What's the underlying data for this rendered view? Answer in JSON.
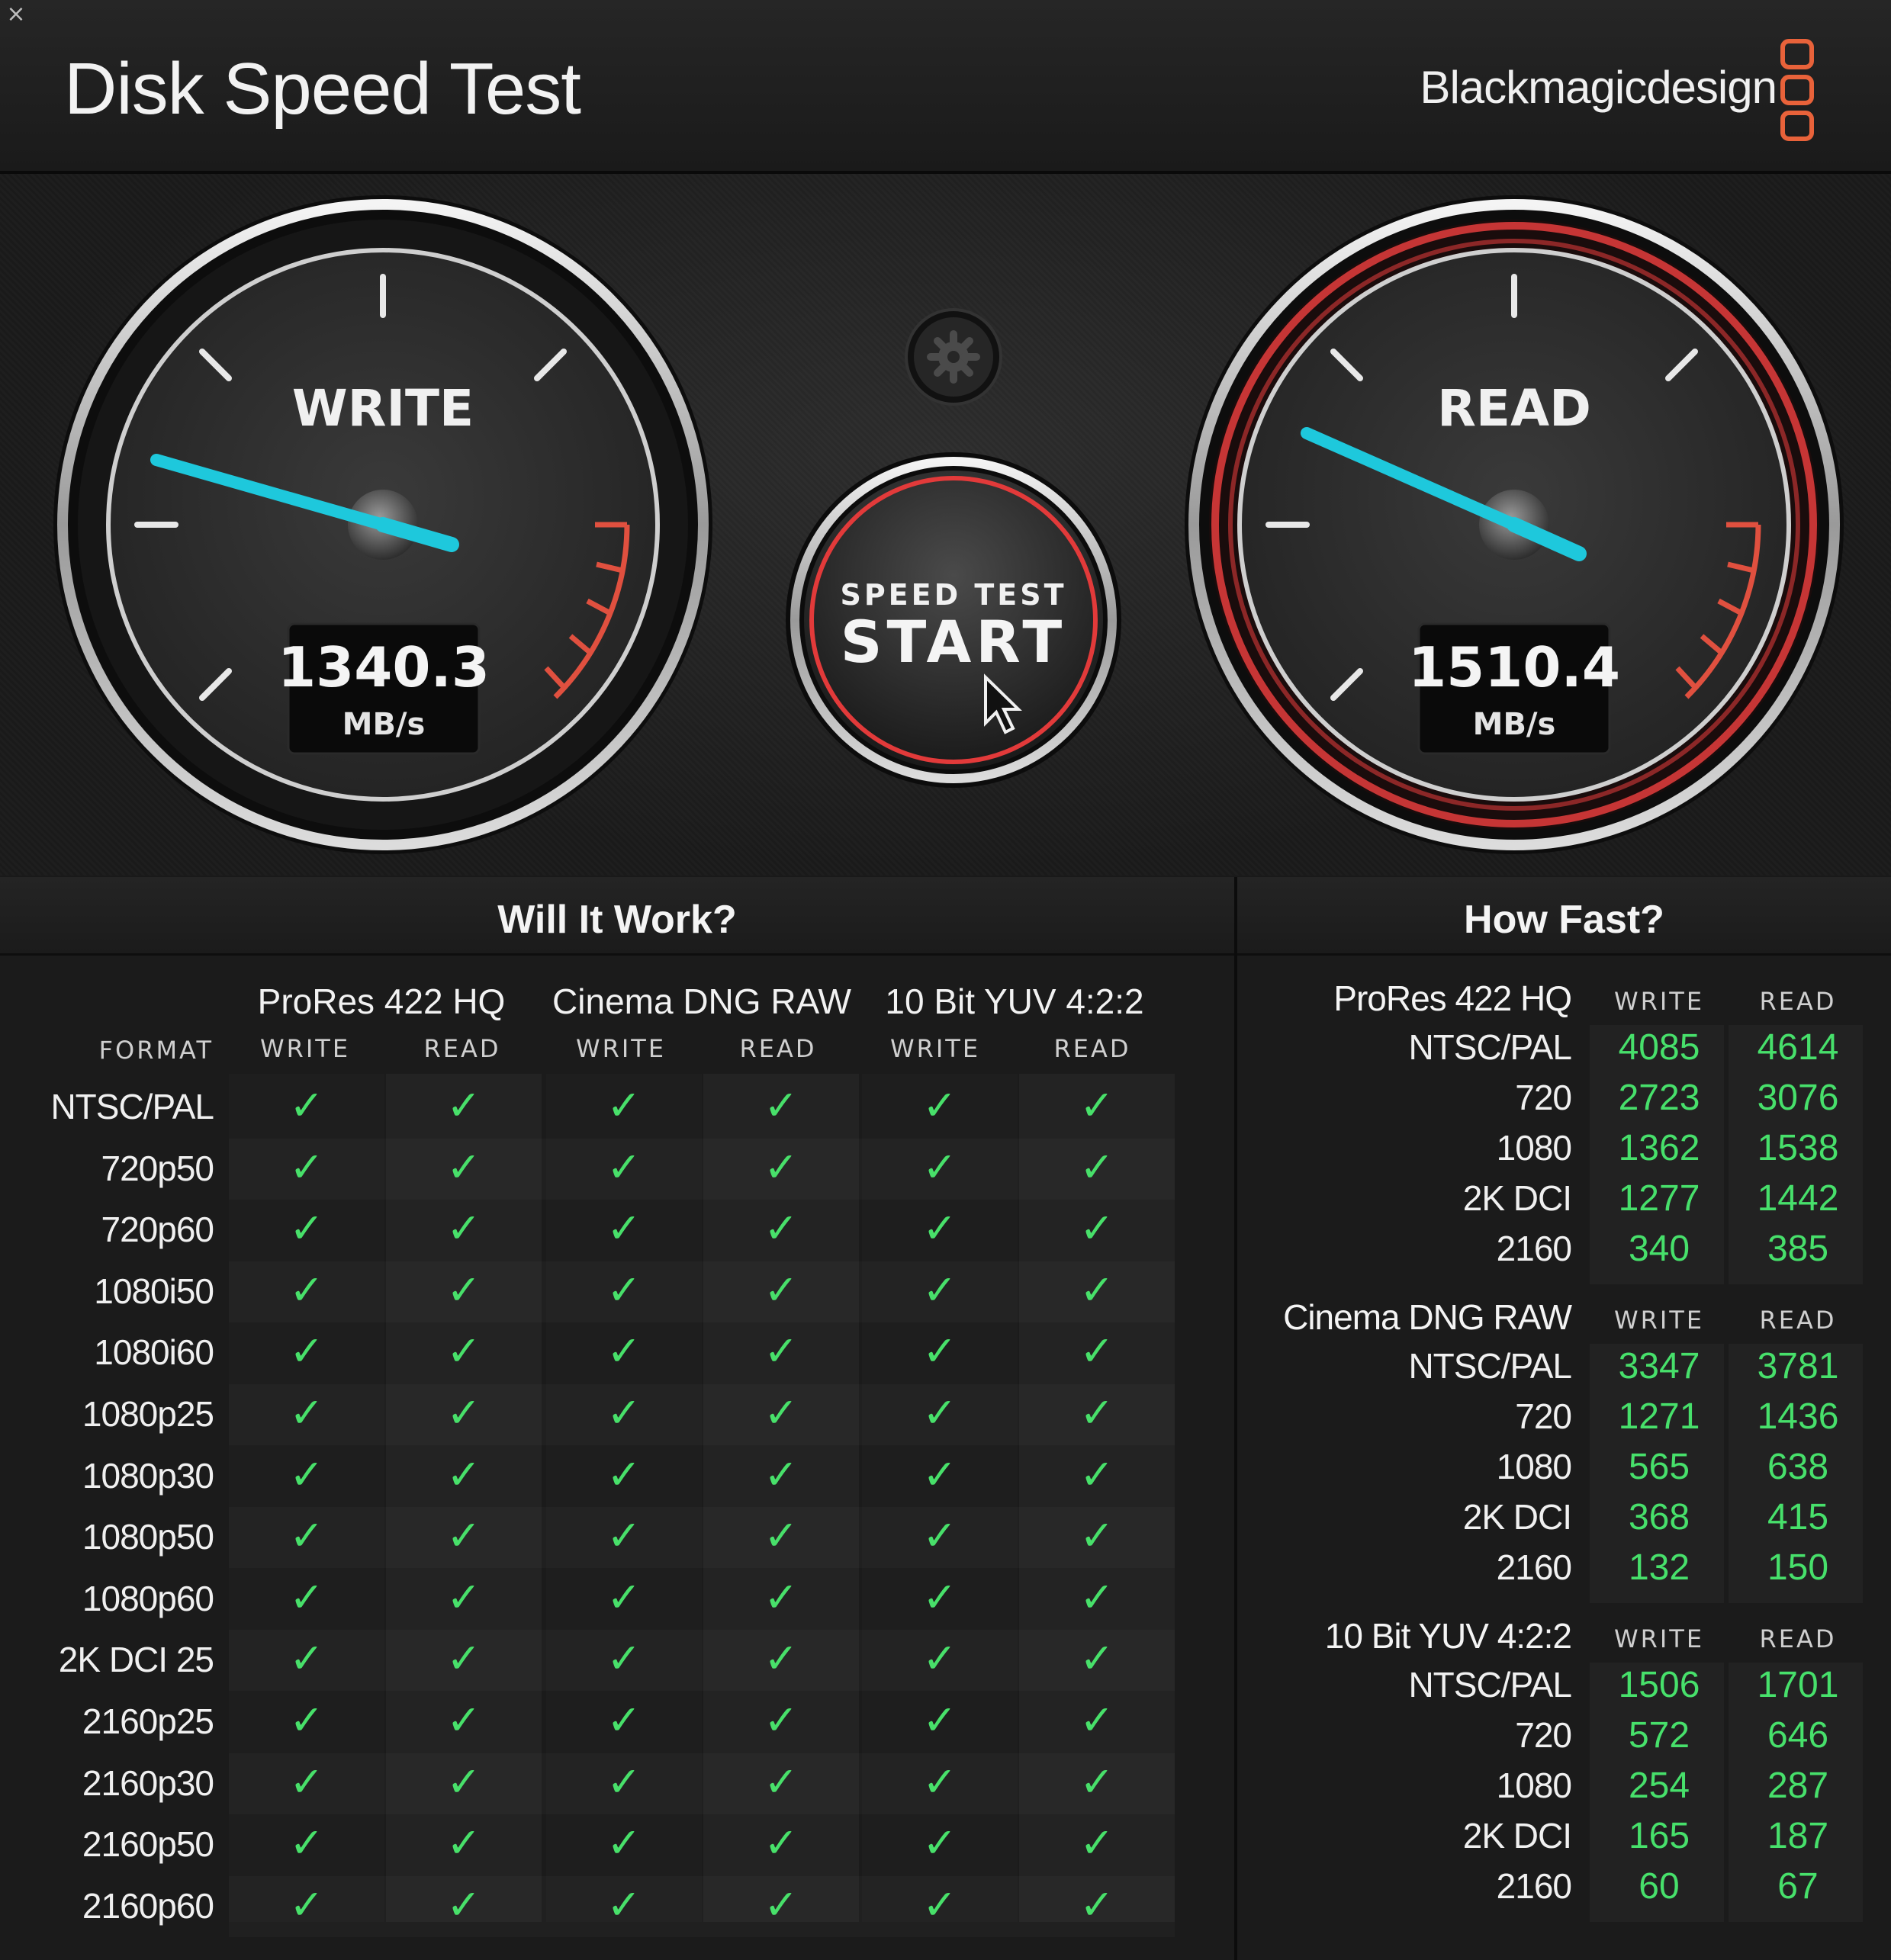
{
  "window": {
    "title": "Disk Speed Test",
    "brand": "Blackmagicdesign",
    "close_glyph": "×"
  },
  "gauges": {
    "write": {
      "label": "WRITE",
      "value": "1340.3",
      "unit": "MB/s"
    },
    "read": {
      "label": "READ",
      "value": "1510.4",
      "unit": "MB/s"
    },
    "start_button": {
      "top": "SPEED TEST",
      "main": "START"
    },
    "settings_icon": "gear-icon"
  },
  "will_it_work": {
    "title": "Will It Work?",
    "format_header": "FORMAT",
    "groups": [
      {
        "name": "ProRes 422 HQ",
        "write": "WRITE",
        "read": "READ"
      },
      {
        "name": "Cinema DNG RAW",
        "write": "WRITE",
        "read": "READ"
      },
      {
        "name": "10 Bit YUV 4:2:2",
        "write": "WRITE",
        "read": "READ"
      }
    ],
    "check_glyph": "✓",
    "formats": [
      "NTSC/PAL",
      "720p50",
      "720p60",
      "1080i50",
      "1080i60",
      "1080p25",
      "1080p30",
      "1080p50",
      "1080p60",
      "2K DCI 25",
      "2160p25",
      "2160p30",
      "2160p50",
      "2160p60"
    ],
    "all_supported": true
  },
  "how_fast": {
    "title": "How Fast?",
    "groups": [
      {
        "name": "ProRes 422 HQ",
        "write": "WRITE",
        "read": "READ",
        "rows": [
          {
            "label": "NTSC/PAL",
            "write": "4085",
            "read": "4614"
          },
          {
            "label": "720",
            "write": "2723",
            "read": "3076"
          },
          {
            "label": "1080",
            "write": "1362",
            "read": "1538"
          },
          {
            "label": "2K DCI",
            "write": "1277",
            "read": "1442"
          },
          {
            "label": "2160",
            "write": "340",
            "read": "385"
          }
        ]
      },
      {
        "name": "Cinema DNG RAW",
        "write": "WRITE",
        "read": "READ",
        "rows": [
          {
            "label": "NTSC/PAL",
            "write": "3347",
            "read": "3781"
          },
          {
            "label": "720",
            "write": "1271",
            "read": "1436"
          },
          {
            "label": "1080",
            "write": "565",
            "read": "638"
          },
          {
            "label": "2K DCI",
            "write": "368",
            "read": "415"
          },
          {
            "label": "2160",
            "write": "132",
            "read": "150"
          }
        ]
      },
      {
        "name": "10 Bit YUV 4:2:2",
        "write": "WRITE",
        "read": "READ",
        "rows": [
          {
            "label": "NTSC/PAL",
            "write": "1506",
            "read": "1701"
          },
          {
            "label": "720",
            "write": "572",
            "read": "646"
          },
          {
            "label": "1080",
            "write": "254",
            "read": "287"
          },
          {
            "label": "2K DCI",
            "write": "165",
            "read": "187"
          },
          {
            "label": "2160",
            "write": "60",
            "read": "67"
          }
        ]
      }
    ]
  },
  "colors": {
    "needle": "#1ec8dc",
    "check": "#48e06a",
    "value": "#47e06b",
    "read_ring": "#d93a3a",
    "redline": "#e0503f",
    "brand_logo": "#e8623a"
  }
}
